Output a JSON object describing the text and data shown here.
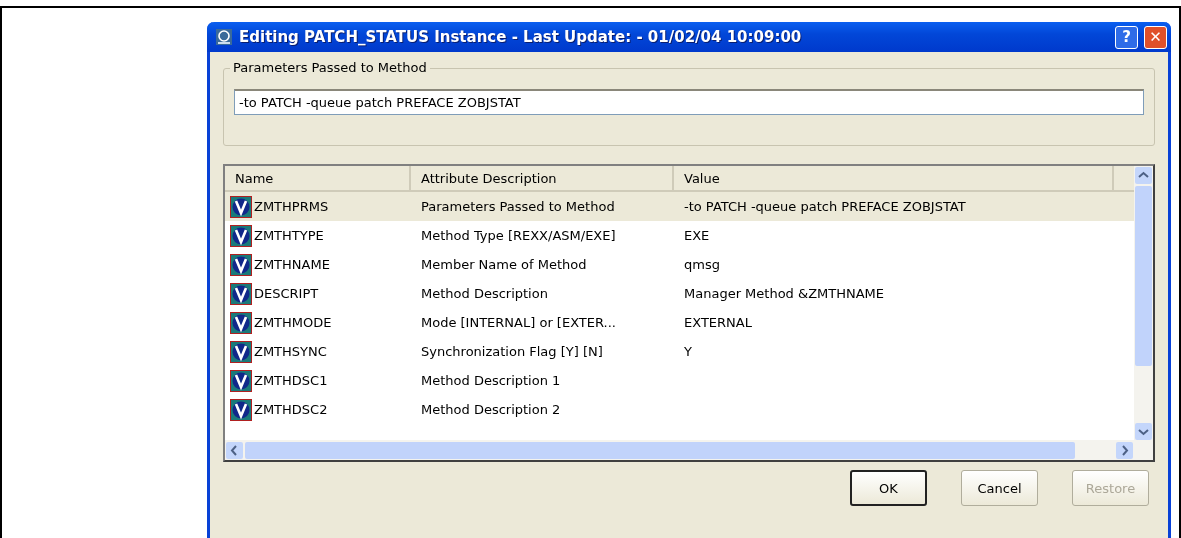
{
  "window": {
    "title": "Editing PATCH_STATUS Instance - Last Update: - 01/02/04 10:09:00",
    "help": "?",
    "close": "✕"
  },
  "parameters": {
    "legend": "Parameters Passed to Method",
    "value": "-to PATCH -queue patch PREFACE ZOBJSTAT"
  },
  "table": {
    "columns": [
      "Name",
      "Attribute Description",
      "Value"
    ],
    "rows": [
      {
        "name": "ZMTHPRMS",
        "description": "Parameters Passed to Method",
        "value": "-to PATCH -queue patch PREFACE ZOBJSTAT",
        "selected": true
      },
      {
        "name": "ZMTHTYPE",
        "description": "Method Type [REXX/ASM/EXE]",
        "value": "EXE",
        "selected": false
      },
      {
        "name": "ZMTHNAME",
        "description": "Member Name of Method",
        "value": "qmsg",
        "selected": false
      },
      {
        "name": "DESCRIPT",
        "description": "Method Description",
        "value": "Manager Method &ZMTHNAME",
        "selected": false
      },
      {
        "name": "ZMTHMODE",
        "description": "Mode [INTERNAL] or [EXTER...",
        "value": "EXTERNAL",
        "selected": false
      },
      {
        "name": "ZMTHSYNC",
        "description": "Synchronization Flag [Y] [N]",
        "value": "Y",
        "selected": false
      },
      {
        "name": "ZMTHDSC1",
        "description": "Method Description 1",
        "selected": false
      },
      {
        "name": "ZMTHDSC2",
        "description": "Method Description 2",
        "selected": false
      }
    ]
  },
  "buttons": [
    {
      "label": "OK",
      "default": true,
      "disabled": false
    },
    {
      "label": "Cancel",
      "default": false,
      "disabled": false
    },
    {
      "label": "Restore",
      "default": false,
      "disabled": true
    }
  ]
}
